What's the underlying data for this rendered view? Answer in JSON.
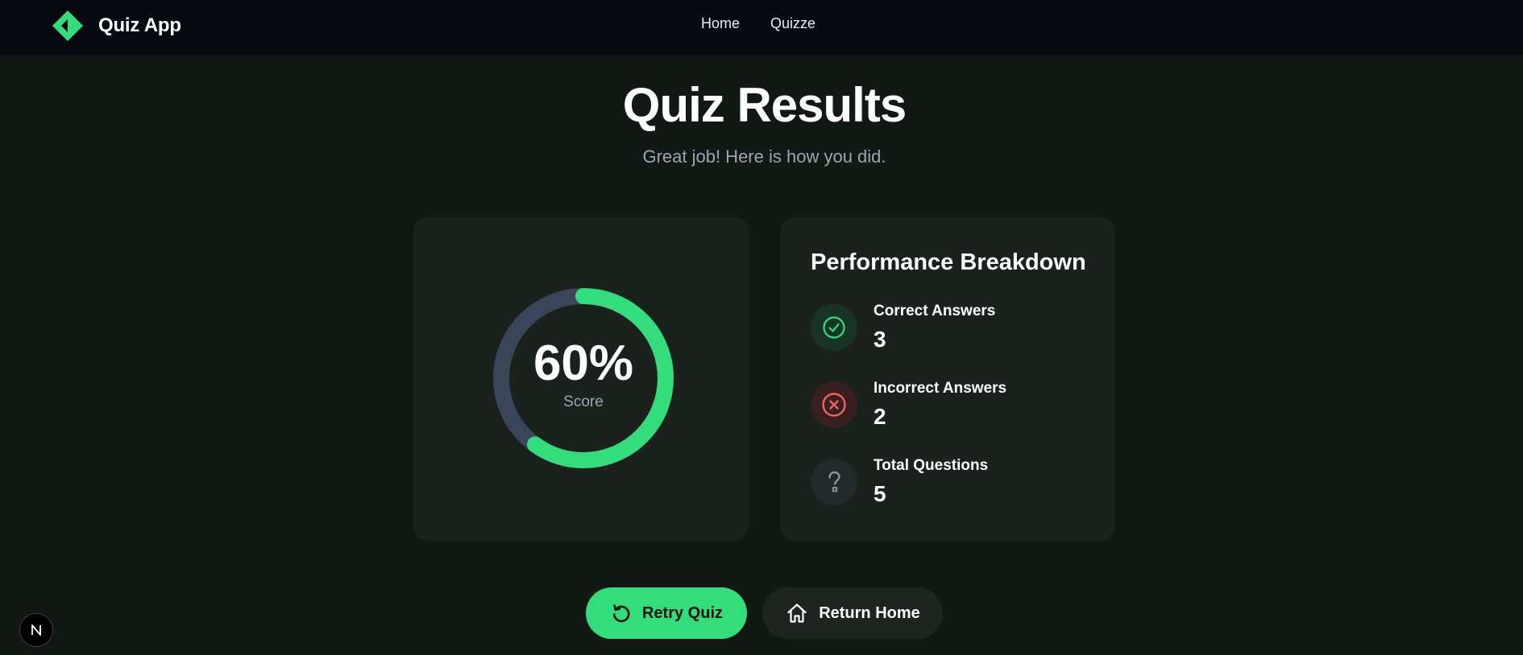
{
  "header": {
    "app_name": "Quiz App",
    "nav": [
      {
        "label": "Home"
      },
      {
        "label": "Quizze"
      }
    ]
  },
  "page": {
    "title": "Quiz Results",
    "subtitle": "Great job! Here is how you did."
  },
  "score": {
    "value_text": "60%",
    "label": "Score",
    "fraction": 0.6
  },
  "breakdown": {
    "title": "Performance Breakdown",
    "stats": [
      {
        "label": "Correct Answers",
        "value": "3",
        "icon": "check-circle-icon"
      },
      {
        "label": "Incorrect Answers",
        "value": "2",
        "icon": "x-circle-icon"
      },
      {
        "label": "Total Questions",
        "value": "5",
        "icon": "question-mark-icon"
      }
    ]
  },
  "actions": {
    "retry_label": "Retry Quiz",
    "home_label": "Return Home"
  },
  "colors": {
    "accent": "#33dd7b",
    "track": "#3a4559",
    "error": "#f06262",
    "background": "#121814",
    "card": "#1b211d",
    "topbar": "#070b11"
  }
}
